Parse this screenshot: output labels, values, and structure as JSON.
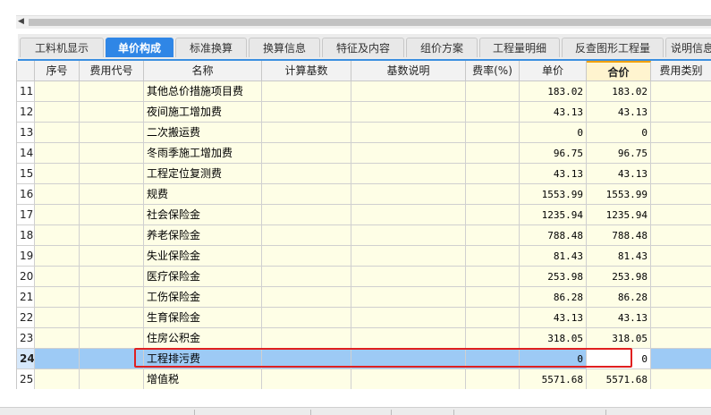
{
  "tabs": [
    "工料机显示",
    "单价构成",
    "标准换算",
    "换算信息",
    "特征及内容",
    "组价方案",
    "工程量明细",
    "反查图形工程量",
    "说明信息"
  ],
  "active_tab": "单价构成",
  "columns": [
    "",
    "序号",
    "费用代号",
    "名称",
    "计算基数",
    "基数说明",
    "费率(%)",
    "单价",
    "合价",
    "费用类别"
  ],
  "rows": [
    {
      "n": "11",
      "name": "其他总价措施项目费",
      "price": "183.02",
      "total": "183.02"
    },
    {
      "n": "12",
      "name": "夜间施工增加费",
      "price": "43.13",
      "total": "43.13"
    },
    {
      "n": "13",
      "name": "二次搬运费",
      "price": "0",
      "total": "0"
    },
    {
      "n": "14",
      "name": "冬雨季施工增加费",
      "price": "96.75",
      "total": "96.75"
    },
    {
      "n": "15",
      "name": "工程定位复测费",
      "price": "43.13",
      "total": "43.13"
    },
    {
      "n": "16",
      "name": "规费",
      "price": "1553.99",
      "total": "1553.99"
    },
    {
      "n": "17",
      "name": "社会保险金",
      "price": "1235.94",
      "total": "1235.94"
    },
    {
      "n": "18",
      "name": "养老保险金",
      "price": "788.48",
      "total": "788.48"
    },
    {
      "n": "19",
      "name": "失业保险金",
      "price": "81.43",
      "total": "81.43"
    },
    {
      "n": "20",
      "name": "医疗保险金",
      "price": "253.98",
      "total": "253.98"
    },
    {
      "n": "21",
      "name": "工伤保险金",
      "price": "86.28",
      "total": "86.28"
    },
    {
      "n": "22",
      "name": "生育保险金",
      "price": "43.13",
      "total": "43.13"
    },
    {
      "n": "23",
      "name": "住房公积金",
      "price": "318.05",
      "total": "318.05"
    },
    {
      "n": "24",
      "name": "工程排污费",
      "price": "0",
      "total": "0",
      "selected": true
    },
    {
      "n": "25",
      "name": "增值税",
      "price": "5571.68",
      "total": "5571.68"
    }
  ],
  "colors": {
    "active_tab": "#2f86e6",
    "selected_row": "#9dcaf5",
    "highlight_box": "#e02020"
  }
}
